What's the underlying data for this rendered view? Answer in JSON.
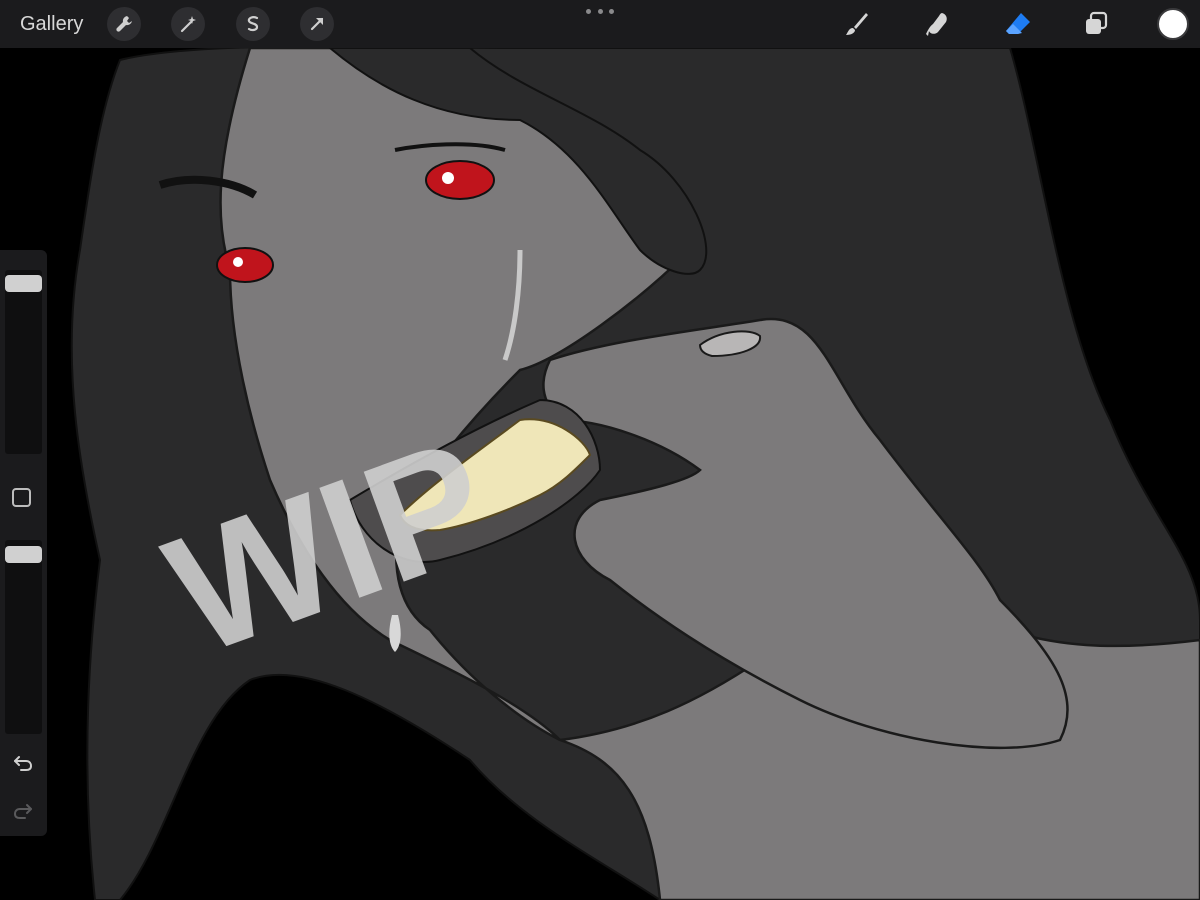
{
  "toolbar": {
    "gallery_label": "Gallery",
    "left_tools": [
      "wrench-icon",
      "magic-wand-icon",
      "selection-icon",
      "transform-arrow-icon"
    ],
    "right_tools": [
      "brush-icon",
      "smudge-icon",
      "eraser-icon",
      "layers-icon"
    ],
    "active_tool": "eraser",
    "active_color": "#ffffff",
    "accent_color": "#1e7cf2"
  },
  "sidebar": {
    "brush_size_level": 0.97,
    "opacity_level": 0.97,
    "modify_button": "square-icon",
    "undo": "undo-icon",
    "redo": "redo-icon"
  },
  "canvas": {
    "annotation_text": "WIP",
    "palette": {
      "background": "#000000",
      "hair": "#2a2a2b",
      "skin": "#7c7a7b",
      "iris": "#c0141c",
      "teeth": "#efe6b8"
    }
  }
}
